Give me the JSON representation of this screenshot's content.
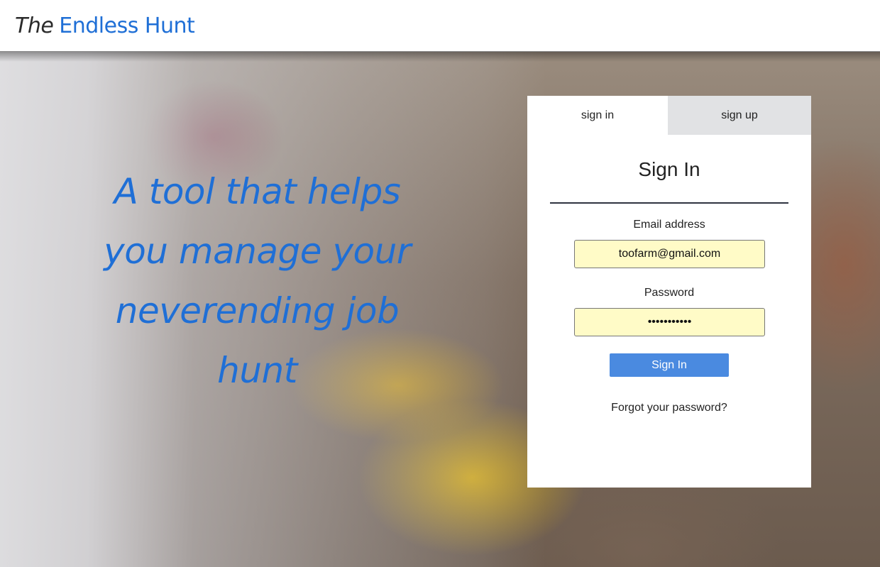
{
  "header": {
    "brand_prefix": "The",
    "brand_name": "Endless Hunt"
  },
  "hero": {
    "tagline": "A tool that helps you manage your neverending job hunt"
  },
  "auth": {
    "tabs": [
      {
        "label": "sign in",
        "active": true
      },
      {
        "label": "sign up",
        "active": false
      }
    ],
    "title": "Sign In",
    "email_label": "Email address",
    "email_value": "toofarm@gmail.com",
    "password_label": "Password",
    "password_value": "•••••••••••",
    "submit_label": "Sign In",
    "forgot_label": "Forgot your password?"
  },
  "colors": {
    "brand_blue": "#1f6fd6",
    "button_blue": "#4a8ae0",
    "autofill_yellow": "#fffbc7",
    "inactive_tab": "#e1e2e4"
  }
}
